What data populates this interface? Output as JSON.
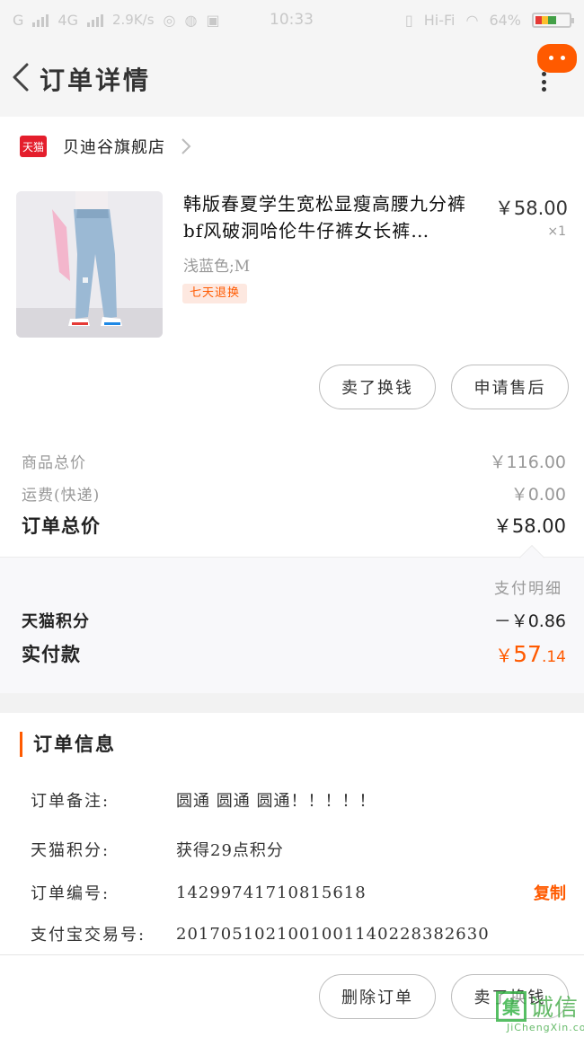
{
  "status_bar": {
    "carrier_left": "G",
    "network": "4G",
    "speed": "2.9K/s",
    "time": "10:33",
    "hifi": "Hi-Fi",
    "battery": "64%",
    "battery_level": 0.64
  },
  "header": {
    "title": "订单详情"
  },
  "shop": {
    "badge": "天猫",
    "name": "贝迪谷旗舰店"
  },
  "product": {
    "title": "韩版春夏学生宽松显瘦高腰九分裤bf风破洞哈伦牛仔裤女长裤…",
    "price": "￥58.00",
    "quantity": "×1",
    "spec": "浅蓝色;M",
    "tag": "七天退换"
  },
  "item_actions": {
    "resell": "卖了换钱",
    "after_sale": "申请售后"
  },
  "summary": {
    "goods_total_label": "商品总价",
    "goods_total": "￥116.00",
    "shipping_label": "运费(快递)",
    "shipping": "￥0.00",
    "order_total_label": "订单总价",
    "order_total": "￥58.00"
  },
  "payment": {
    "detail_link": "支付明细",
    "points_label": "天猫积分",
    "points_value": "－￥0.86",
    "paid_label": "实付款",
    "paid_currency": "￥",
    "paid_int": "57",
    "paid_dec": ".14"
  },
  "order_info": {
    "section_title": "订单信息",
    "rows": [
      {
        "key": "订单备注:",
        "value": "圆通 圆通 圆通！！！！！"
      },
      {
        "key": "天猫积分:",
        "value": "获得29点积分"
      },
      {
        "key": "订单编号:",
        "value": "14299741710815618"
      },
      {
        "key": "支付宝交易号:",
        "value": "2017051021001001140228382630"
      }
    ],
    "copy_label": "复制"
  },
  "bottom_bar": {
    "delete_order": "删除订单",
    "resell": "卖了换钱"
  },
  "watermark": {
    "char": "集",
    "text": "诚信",
    "url": "JiChengXin.com"
  },
  "colors": {
    "accent": "#ff5a00",
    "tmall_red": "#e41e2c",
    "muted_text": "#999999"
  }
}
